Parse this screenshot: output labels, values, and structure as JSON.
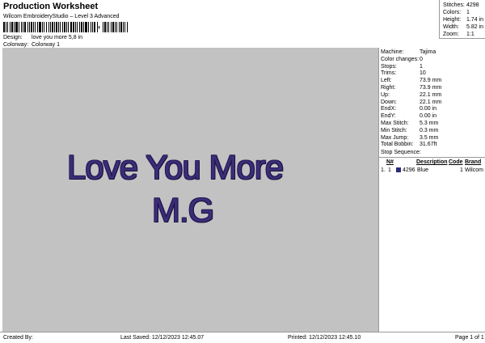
{
  "header": {
    "title": "Production Worksheet",
    "subtitle": "Wilcom EmbroideryStudio – Level 3 Advanced",
    "barcode_suffix": ","
  },
  "design": {
    "label": "Design:",
    "value": "love you more 5,8 in"
  },
  "colorway": {
    "label": "Colorway:",
    "value": "Colorway 1"
  },
  "stats": [
    {
      "label": "Stitches:",
      "value": "4298"
    },
    {
      "label": "Colors:",
      "value": "1"
    },
    {
      "label": "Height:",
      "value": "1.74 in"
    },
    {
      "label": "Width:",
      "value": "5.82 in"
    },
    {
      "label": "Zoom:",
      "value": "1:1"
    }
  ],
  "canvas": {
    "text_line1": "Love You More",
    "text_line2": "M.G",
    "thread_color": "#3d2d78",
    "background": "#c2c2c2"
  },
  "machine_info": [
    {
      "label": "Machine:",
      "value": "Tajima"
    },
    {
      "label": "Color changes:",
      "value": "0"
    },
    {
      "label": "Stops:",
      "value": "1"
    },
    {
      "label": "Trims:",
      "value": "10"
    },
    {
      "label": "Left:",
      "value": "73.9 mm"
    },
    {
      "label": "Right:",
      "value": "73.9 mm"
    },
    {
      "label": "Up:",
      "value": "22.1 mm"
    },
    {
      "label": "Down:",
      "value": "22.1 mm"
    },
    {
      "label": "EndX:",
      "value": "0.00 in"
    },
    {
      "label": "EndY:",
      "value": "0.00 in"
    },
    {
      "label": "Max Stitch:",
      "value": "5.3 mm"
    },
    {
      "label": "Min Stitch:",
      "value": "0.3 mm"
    },
    {
      "label": "Max Jump:",
      "value": "3.5 mm"
    },
    {
      "label": "Total Bobbin:",
      "value": "31.67ft"
    }
  ],
  "stop_sequence": {
    "title": "Stop Sequence:",
    "headers": {
      "no": "N#",
      "description": "Description",
      "code": "Code",
      "brand": "Brand"
    },
    "rows": [
      {
        "index": "1.",
        "no": "1",
        "stitches": "4296",
        "description": "Blue",
        "code": "1",
        "brand": "Wilcom",
        "swatch": "#2a2a7a"
      }
    ]
  },
  "footer": {
    "created_by": "Created By:",
    "last_saved": "Last Saved: 12/12/2023 12:45.07",
    "printed": "Printed: 12/12/2023 12:45.10",
    "page": "Page 1 of 1"
  }
}
